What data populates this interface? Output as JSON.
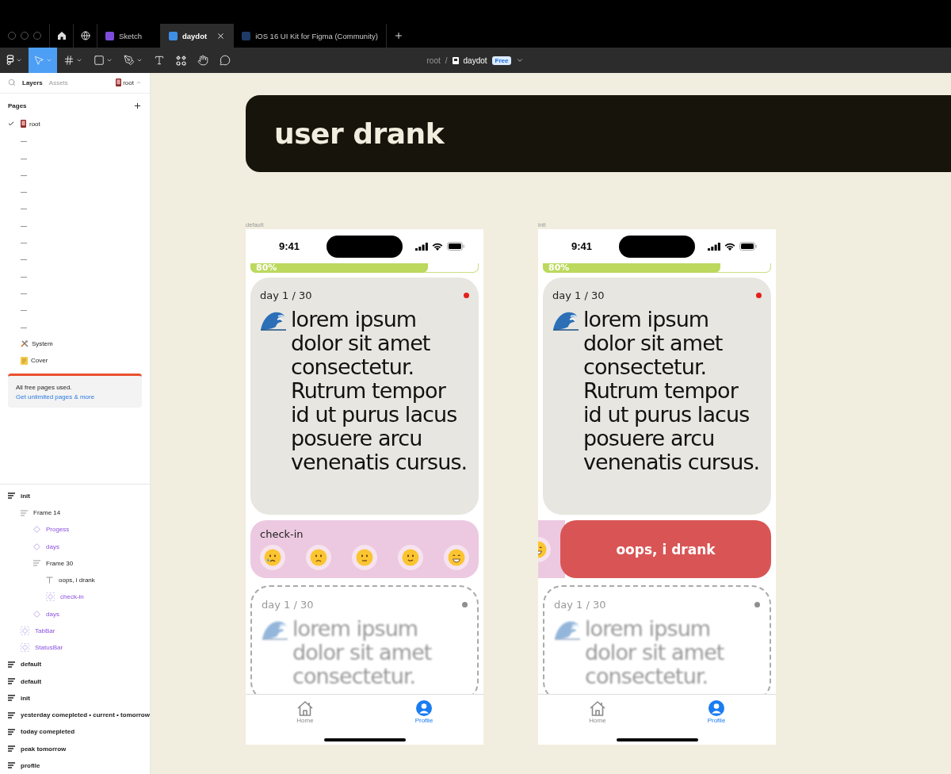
{
  "browser_tabs": [
    {
      "label": "Sketch",
      "color": "#7c4ddb",
      "selected": false,
      "closable": false
    },
    {
      "label": "daydot",
      "color": "#3d8fe6",
      "selected": true,
      "closable": true
    },
    {
      "label": "iOS 16 UI Kit for Figma (Community)",
      "color": "#1f3a66",
      "selected": false,
      "closable": false
    }
  ],
  "toolbar": {
    "tools": [
      {
        "kind": "figma",
        "selected": false,
        "menu": true
      },
      {
        "kind": "move",
        "selected": true,
        "menu": true
      },
      {
        "kind": "frame",
        "selected": false,
        "menu": true
      },
      {
        "kind": "shape",
        "selected": false,
        "menu": true
      },
      {
        "kind": "pen",
        "selected": false,
        "menu": true
      },
      {
        "kind": "text",
        "selected": false,
        "menu": false
      },
      {
        "kind": "resources",
        "selected": false,
        "menu": false
      },
      {
        "kind": "hand",
        "selected": false,
        "menu": false
      },
      {
        "kind": "comment",
        "selected": false,
        "menu": false
      }
    ],
    "breadcrumb": {
      "parent": "root",
      "separator": "/",
      "file": "daydot",
      "plan": "Free"
    }
  },
  "sidebar": {
    "tabs": [
      {
        "label": "Layers",
        "selected": true
      },
      {
        "label": "Assets",
        "selected": false
      }
    ],
    "page_switch": "root",
    "pages_heading": "Pages",
    "pages": [
      {
        "label": "root",
        "kind": "phone",
        "selected": true
      },
      {
        "label": "—",
        "selected": false
      },
      {
        "label": "—",
        "selected": false
      },
      {
        "label": "—",
        "selected": false
      },
      {
        "label": "—",
        "selected": false
      },
      {
        "label": "—",
        "selected": false
      },
      {
        "label": "—",
        "selected": false
      },
      {
        "label": "—",
        "selected": false
      },
      {
        "label": "—",
        "selected": false
      },
      {
        "label": "—",
        "selected": false
      },
      {
        "label": "—",
        "selected": false
      },
      {
        "label": "—",
        "selected": false
      },
      {
        "label": "—",
        "selected": false
      },
      {
        "label": "System",
        "kind": "tools",
        "selected": false
      },
      {
        "label": "Cover",
        "kind": "note",
        "selected": false
      }
    ],
    "notice": {
      "text": "All free pages used.",
      "link": "Get unlimited pages & more"
    },
    "layers": [
      {
        "label": "init",
        "kind": "frame",
        "children": [
          {
            "label": "Frame 14",
            "kind": "stack",
            "children": [
              {
                "label": "Progess",
                "kind": "component"
              },
              {
                "label": "days",
                "kind": "component"
              },
              {
                "label": "Frame 30",
                "kind": "stack",
                "children": [
                  {
                    "label": "oops, i drank",
                    "kind": "text"
                  },
                  {
                    "label": "check-in",
                    "kind": "instance"
                  }
                ]
              },
              {
                "label": "days",
                "kind": "component"
              }
            ]
          },
          {
            "label": "TabBar",
            "kind": "instance"
          },
          {
            "label": "StatusBar",
            "kind": "instance"
          }
        ]
      },
      {
        "label": "default",
        "kind": "frame"
      },
      {
        "label": "default",
        "kind": "frame"
      },
      {
        "label": "init",
        "kind": "frame"
      },
      {
        "label": "yesterday comepleted • current • tomorrow",
        "kind": "frame"
      },
      {
        "label": "today comepleted",
        "kind": "frame"
      },
      {
        "label": "peak tomorrow",
        "kind": "frame"
      },
      {
        "label": "profile",
        "kind": "frame"
      }
    ]
  },
  "canvas": {
    "banner": "user drank",
    "frames": [
      {
        "label": "default",
        "time": "9:41",
        "progress": {
          "label": "80%",
          "level": 0.78
        },
        "cards": [
          {
            "kind": "day",
            "counter": "day 1 / 30",
            "color": "#e3211b",
            "text": "lorem ipsum dolor sit amet consectetur. Rutrum tempor id ut purus lacus posuere arcu venenatis cursus."
          },
          {
            "kind": "checkin",
            "label": "check-in",
            "moods": [
              {
                "kind": "crying"
              },
              {
                "kind": "frown"
              },
              {
                "kind": "neutral"
              },
              {
                "kind": "smile"
              },
              {
                "kind": "grin"
              }
            ]
          },
          {
            "kind": "next",
            "counter": "day 1 / 30",
            "color": "#8f8f8f",
            "text": "lorem ipsum dolor sit amet consectetur."
          }
        ],
        "tabs": [
          {
            "label": "Home",
            "kind": "home",
            "selected": false
          },
          {
            "label": "Profile",
            "kind": "person",
            "selected": true
          }
        ]
      },
      {
        "label": "init",
        "time": "9:41",
        "progress": {
          "label": "80%",
          "level": 0.78
        },
        "cards": [
          {
            "kind": "day",
            "counter": "day 1 / 30",
            "color": "#e3211b",
            "text": "lorem ipsum dolor sit amet consectetur. Rutrum tempor id ut purus lacus posuere arcu venenatis cursus."
          },
          {
            "kind": "oops",
            "peek": {
              "kind": "grin"
            },
            "action": "oops, i drank"
          },
          {
            "kind": "next",
            "counter": "day 1 / 30",
            "color": "#8f8f8f",
            "text": "lorem ipsum dolor sit amet consectetur."
          }
        ],
        "tabs": [
          {
            "label": "Home",
            "kind": "home",
            "selected": false
          },
          {
            "label": "Profile",
            "kind": "person",
            "selected": true
          }
        ]
      }
    ]
  }
}
